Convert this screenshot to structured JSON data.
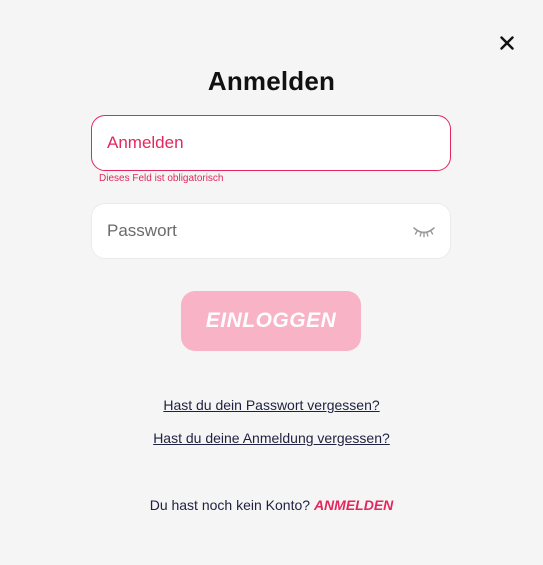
{
  "modal": {
    "title": "Anmelden",
    "close_icon": "close-icon"
  },
  "form": {
    "username": {
      "placeholder": "Anmelden",
      "error": "Dieses Feld ist obligatorisch"
    },
    "password": {
      "placeholder": "Passwort",
      "toggle_icon": "eye-closed-icon"
    },
    "submit_label": "EINLOGGEN"
  },
  "links": {
    "forgot_password": "Hast du dein Passwort vergessen?",
    "forgot_login": "Hast du deine Anmeldung vergessen?"
  },
  "signup": {
    "prompt": "Du hast noch kein Konto?",
    "link_label": "ANMELDEN"
  },
  "colors": {
    "accent": "#e2285f",
    "button_disabled": "#f8b3c6",
    "background": "#f5f5f5",
    "link_text": "#1f2140"
  }
}
